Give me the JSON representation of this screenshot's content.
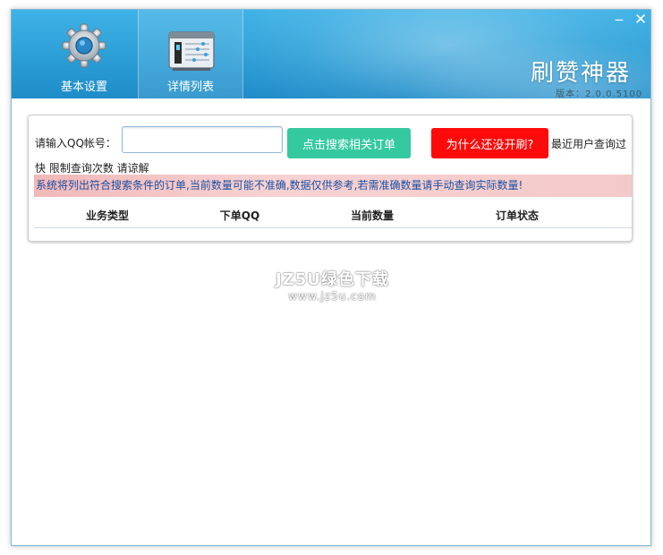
{
  "window": {
    "app_title": "刷赞神器",
    "version": "版本：2.0.0.5100",
    "minimize_glyph": "‒",
    "close_glyph": "✕"
  },
  "tabs": [
    {
      "label": "基本设置",
      "icon": "gear-icon"
    },
    {
      "label": "详情列表",
      "icon": "list-icon"
    }
  ],
  "search": {
    "label": "请输入QQ帐号：",
    "value": "",
    "button_label": "点击搜索相关订单"
  },
  "why_button_label": "为什么还没开刷?",
  "recent_note": {
    "line1": "最近用户查询过",
    "line2": "快 限制查询次数 请谅解"
  },
  "notice": "系统将列出符合搜索条件的订单,当前数量可能不准确,数据仅供参考,若需准确数量请手动查询实际数量!",
  "table": {
    "columns": [
      "业务类型",
      "下单QQ",
      "当前数量",
      "订单状态"
    ]
  },
  "watermark": {
    "line1": "JZ5U绿色下载",
    "line2": "www.jz5u.com"
  },
  "colors": {
    "header": "#2b9ed6",
    "search_button": "#35c9a0",
    "why_button": "#ff0a0a",
    "notice_bg": "#f4c9c9",
    "notice_text": "#1a4fa3"
  }
}
